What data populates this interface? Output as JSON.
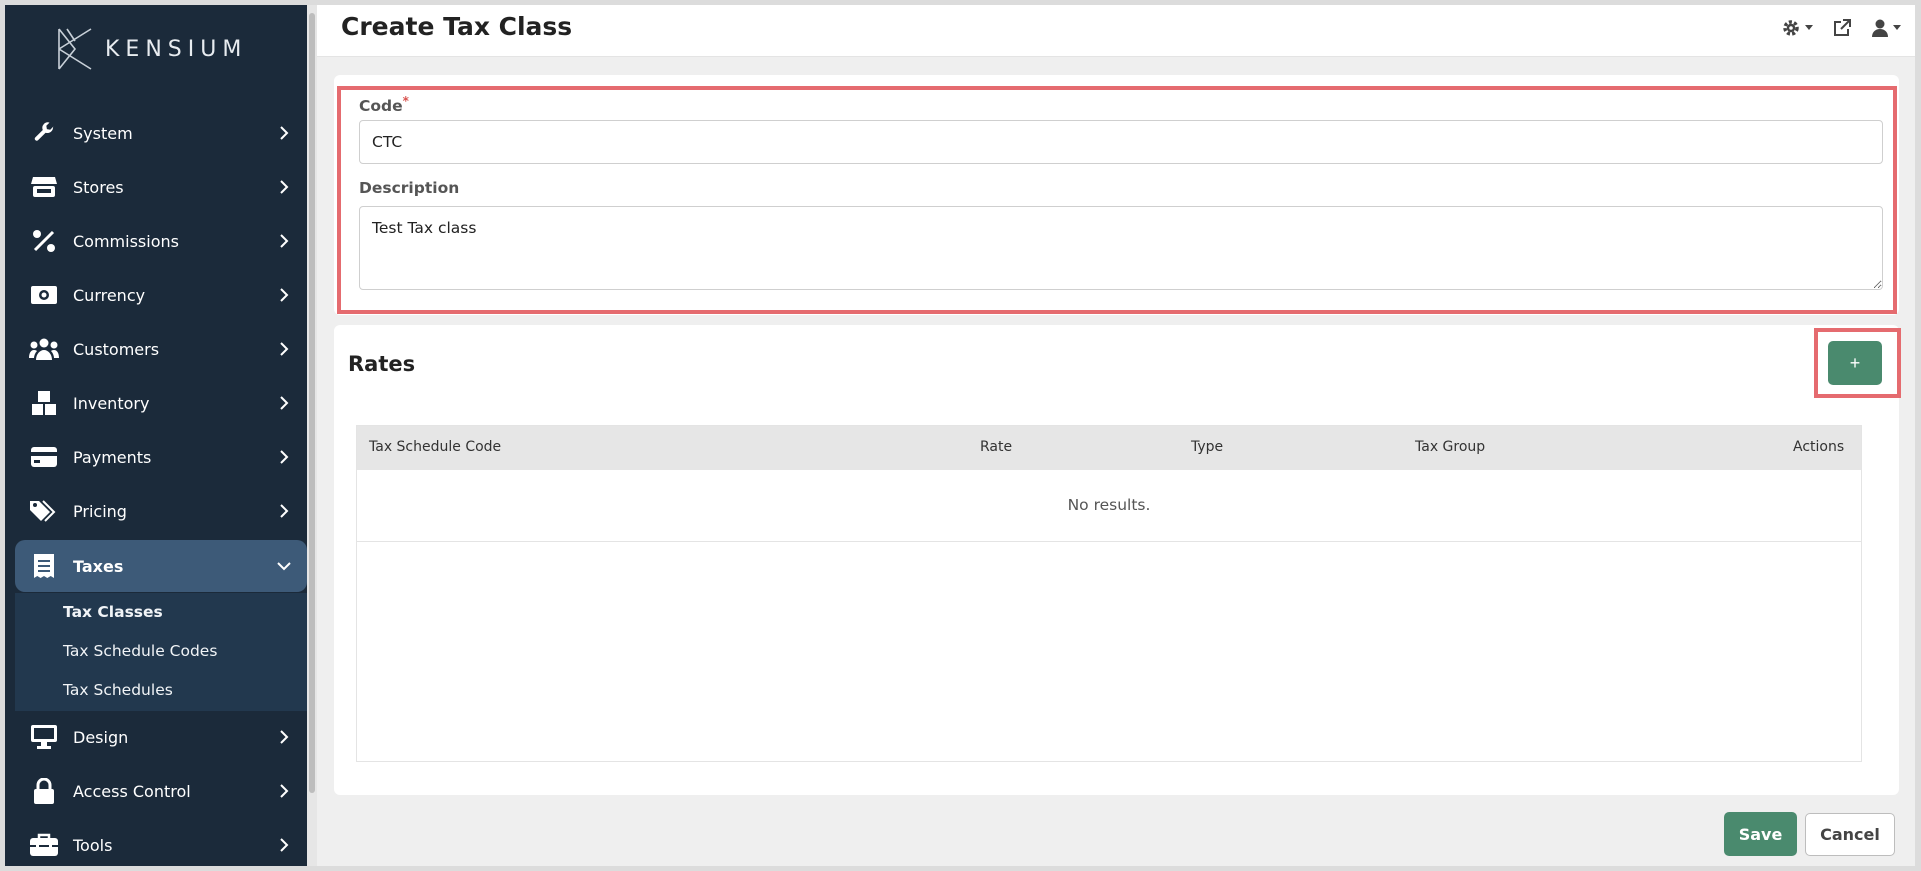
{
  "brand": {
    "name": "KENSIUM"
  },
  "sidebar": {
    "items": [
      {
        "label": "System",
        "icon": "wrench-icon"
      },
      {
        "label": "Stores",
        "icon": "store-icon"
      },
      {
        "label": "Commissions",
        "icon": "percent-icon"
      },
      {
        "label": "Currency",
        "icon": "money-bill-icon"
      },
      {
        "label": "Customers",
        "icon": "users-icon"
      },
      {
        "label": "Inventory",
        "icon": "boxes-icon"
      },
      {
        "label": "Payments",
        "icon": "credit-card-icon"
      },
      {
        "label": "Pricing",
        "icon": "tags-icon"
      },
      {
        "label": "Taxes",
        "icon": "receipt-icon",
        "expanded": true
      },
      {
        "label": "Design",
        "icon": "desktop-icon"
      },
      {
        "label": "Access Control",
        "icon": "lock-icon"
      },
      {
        "label": "Tools",
        "icon": "toolbox-icon"
      }
    ],
    "taxes_sub": [
      {
        "label": "Tax Classes",
        "current": true
      },
      {
        "label": "Tax Schedule Codes"
      },
      {
        "label": "Tax Schedules"
      }
    ]
  },
  "header": {
    "title": "Create Tax Class",
    "icons": [
      "gear-icon",
      "external-link-icon",
      "user-icon"
    ]
  },
  "form": {
    "code_label": "Code",
    "code_required_mark": "*",
    "code_value": "CTC",
    "description_label": "Description",
    "description_value": "Test Tax class"
  },
  "rates": {
    "title": "Rates",
    "add_label": "+",
    "columns": [
      "Tax Schedule Code",
      "Rate",
      "Type",
      "Tax Group",
      "Actions"
    ],
    "empty_text": "No results."
  },
  "footer": {
    "save_label": "Save",
    "cancel_label": "Cancel"
  },
  "colors": {
    "sidebar_bg": "#1b2a3a",
    "active_item": "#3d5a78",
    "primary_button": "#4a8a6e",
    "highlight": "#e56b6f"
  }
}
